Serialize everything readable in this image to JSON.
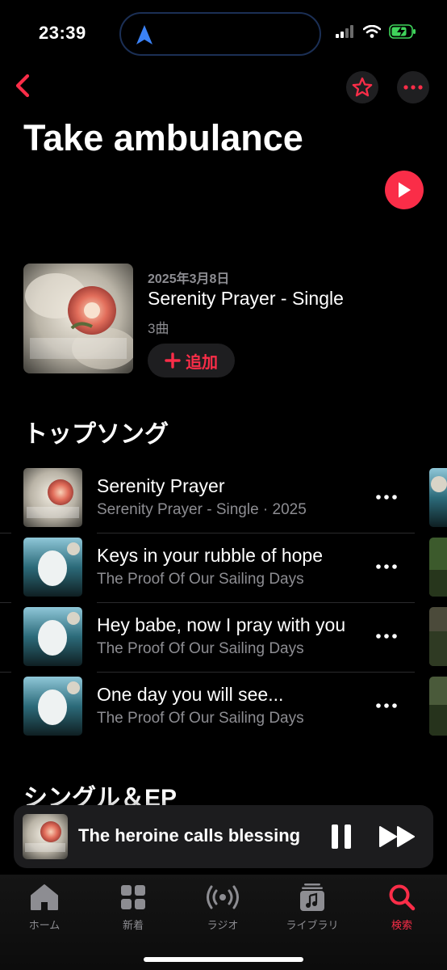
{
  "status_bar": {
    "time": "23:39",
    "icons": [
      "location-arrow-icon",
      "signal-icon",
      "wifi-icon",
      "battery-charging-icon"
    ]
  },
  "header": {
    "back_icon": "chevron-left-icon",
    "favorite_icon": "star-icon",
    "more_icon": "ellipsis-icon"
  },
  "artist": {
    "name": "Take ambulance",
    "play_icon": "play-icon"
  },
  "latest_release": {
    "date": "2025年3月8日",
    "title": "Serenity Prayer - Single",
    "track_count": "3曲",
    "add_label": "追加"
  },
  "top_songs": {
    "title": "トップソング",
    "songs": [
      {
        "name": "Serenity Prayer",
        "subtitle": "Serenity Prayer - Single · 2025"
      },
      {
        "name": "Keys in your rubble of hope",
        "subtitle": "The Proof Of Our Sailing Days"
      },
      {
        "name": "Hey babe, now I pray with you",
        "subtitle": "The Proof Of Our Sailing Days"
      },
      {
        "name": "One day you will see...",
        "subtitle": "The Proof Of Our Sailing Days"
      }
    ]
  },
  "singles_section": {
    "title": "シングル＆EP"
  },
  "now_playing": {
    "title": "The heroine calls blessing"
  },
  "tabs": [
    {
      "label": "ホーム",
      "icon": "home-icon",
      "active": false
    },
    {
      "label": "新着",
      "icon": "grid-icon",
      "active": false
    },
    {
      "label": "ラジオ",
      "icon": "radio-icon",
      "active": false
    },
    {
      "label": "ライブラリ",
      "icon": "library-icon",
      "active": false
    },
    {
      "label": "検索",
      "icon": "search-icon",
      "active": true
    }
  ],
  "colors": {
    "accent": "#fa2d48",
    "background": "#000000",
    "secondary_text": "#8d8d92",
    "surface": "#1c1c1e"
  }
}
